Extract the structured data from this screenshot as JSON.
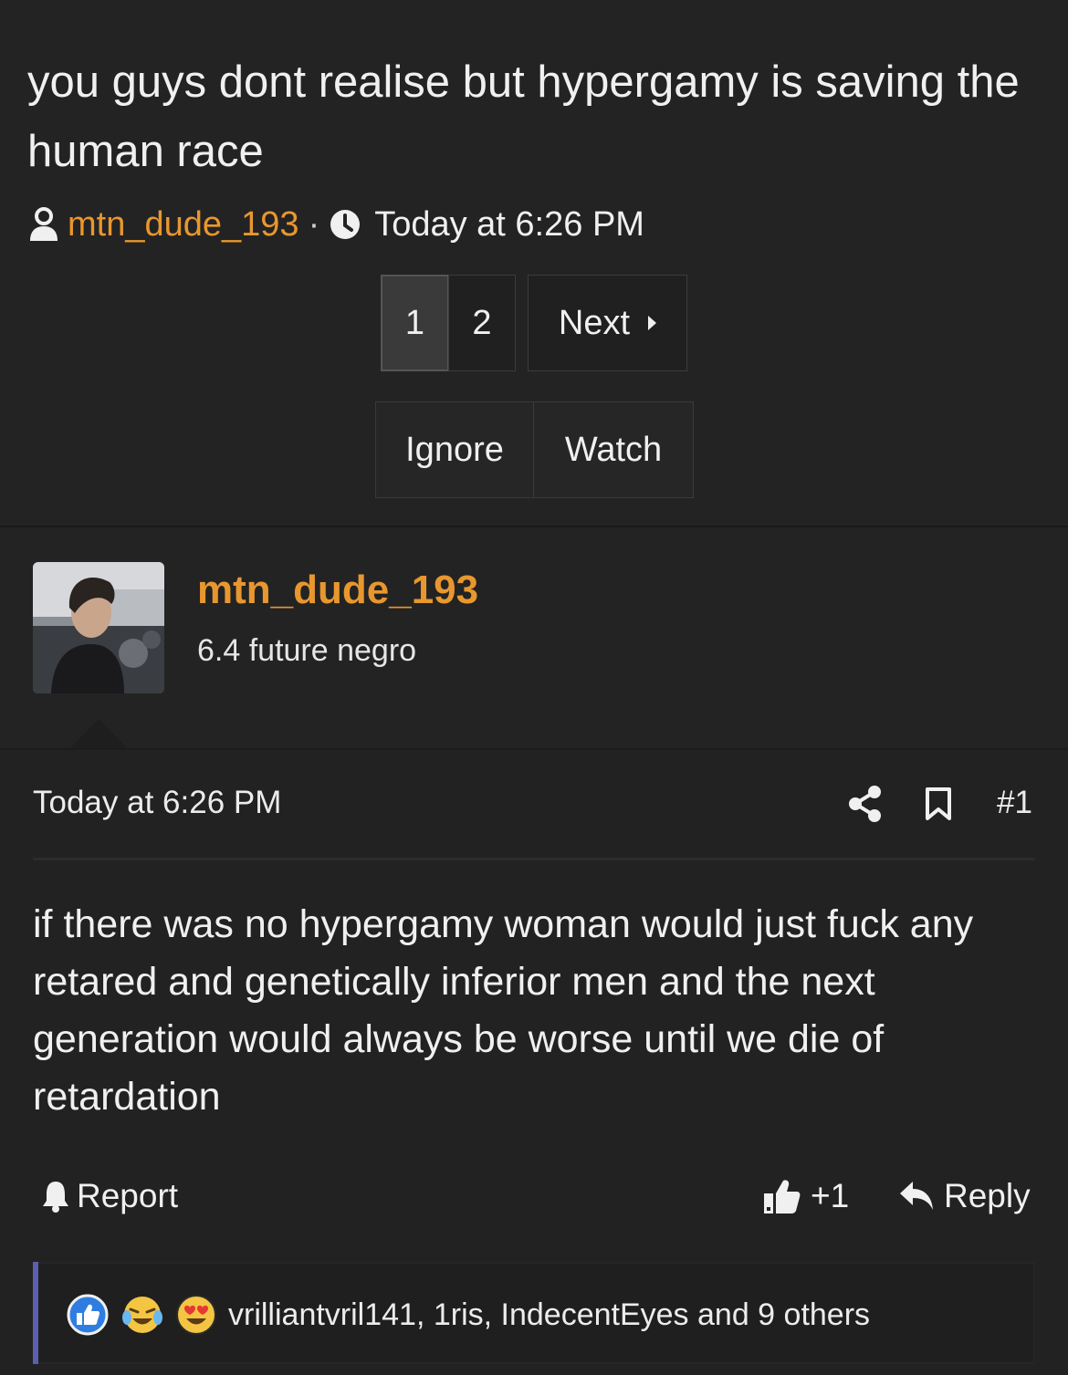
{
  "thread": {
    "title": "you guys dont realise but hypergamy is saving the human race",
    "author": "mtn_dude_193",
    "separator": "·",
    "date": "Today at 6:26 PM"
  },
  "pagination": {
    "pages": [
      "1",
      "2"
    ],
    "current": "1",
    "next_label": "Next"
  },
  "actions": {
    "ignore_label": "Ignore",
    "watch_label": "Watch"
  },
  "user": {
    "name": "mtn_dude_193",
    "title": "6.4 future negro"
  },
  "post": {
    "date": "Today at 6:26 PM",
    "number": "#1",
    "body": "if there was no hypergamy woman would just fuck any retared and genetically inferior men and the next generation would always be worse until we die of retardation",
    "report_label": "Report",
    "like_label": "+1",
    "reply_label": "Reply"
  },
  "reactions": {
    "icons": [
      "like-reaction-icon",
      "laugh-cry-reaction-icon",
      "heart-eyes-reaction-icon"
    ],
    "summary": "vrilliantvril141, 1ris, IndecentEyes and 9 others"
  },
  "colors": {
    "background": "#222223",
    "username": "#e8972f",
    "text": "#f0f0f0",
    "accent_bar": "#5a5fae"
  }
}
